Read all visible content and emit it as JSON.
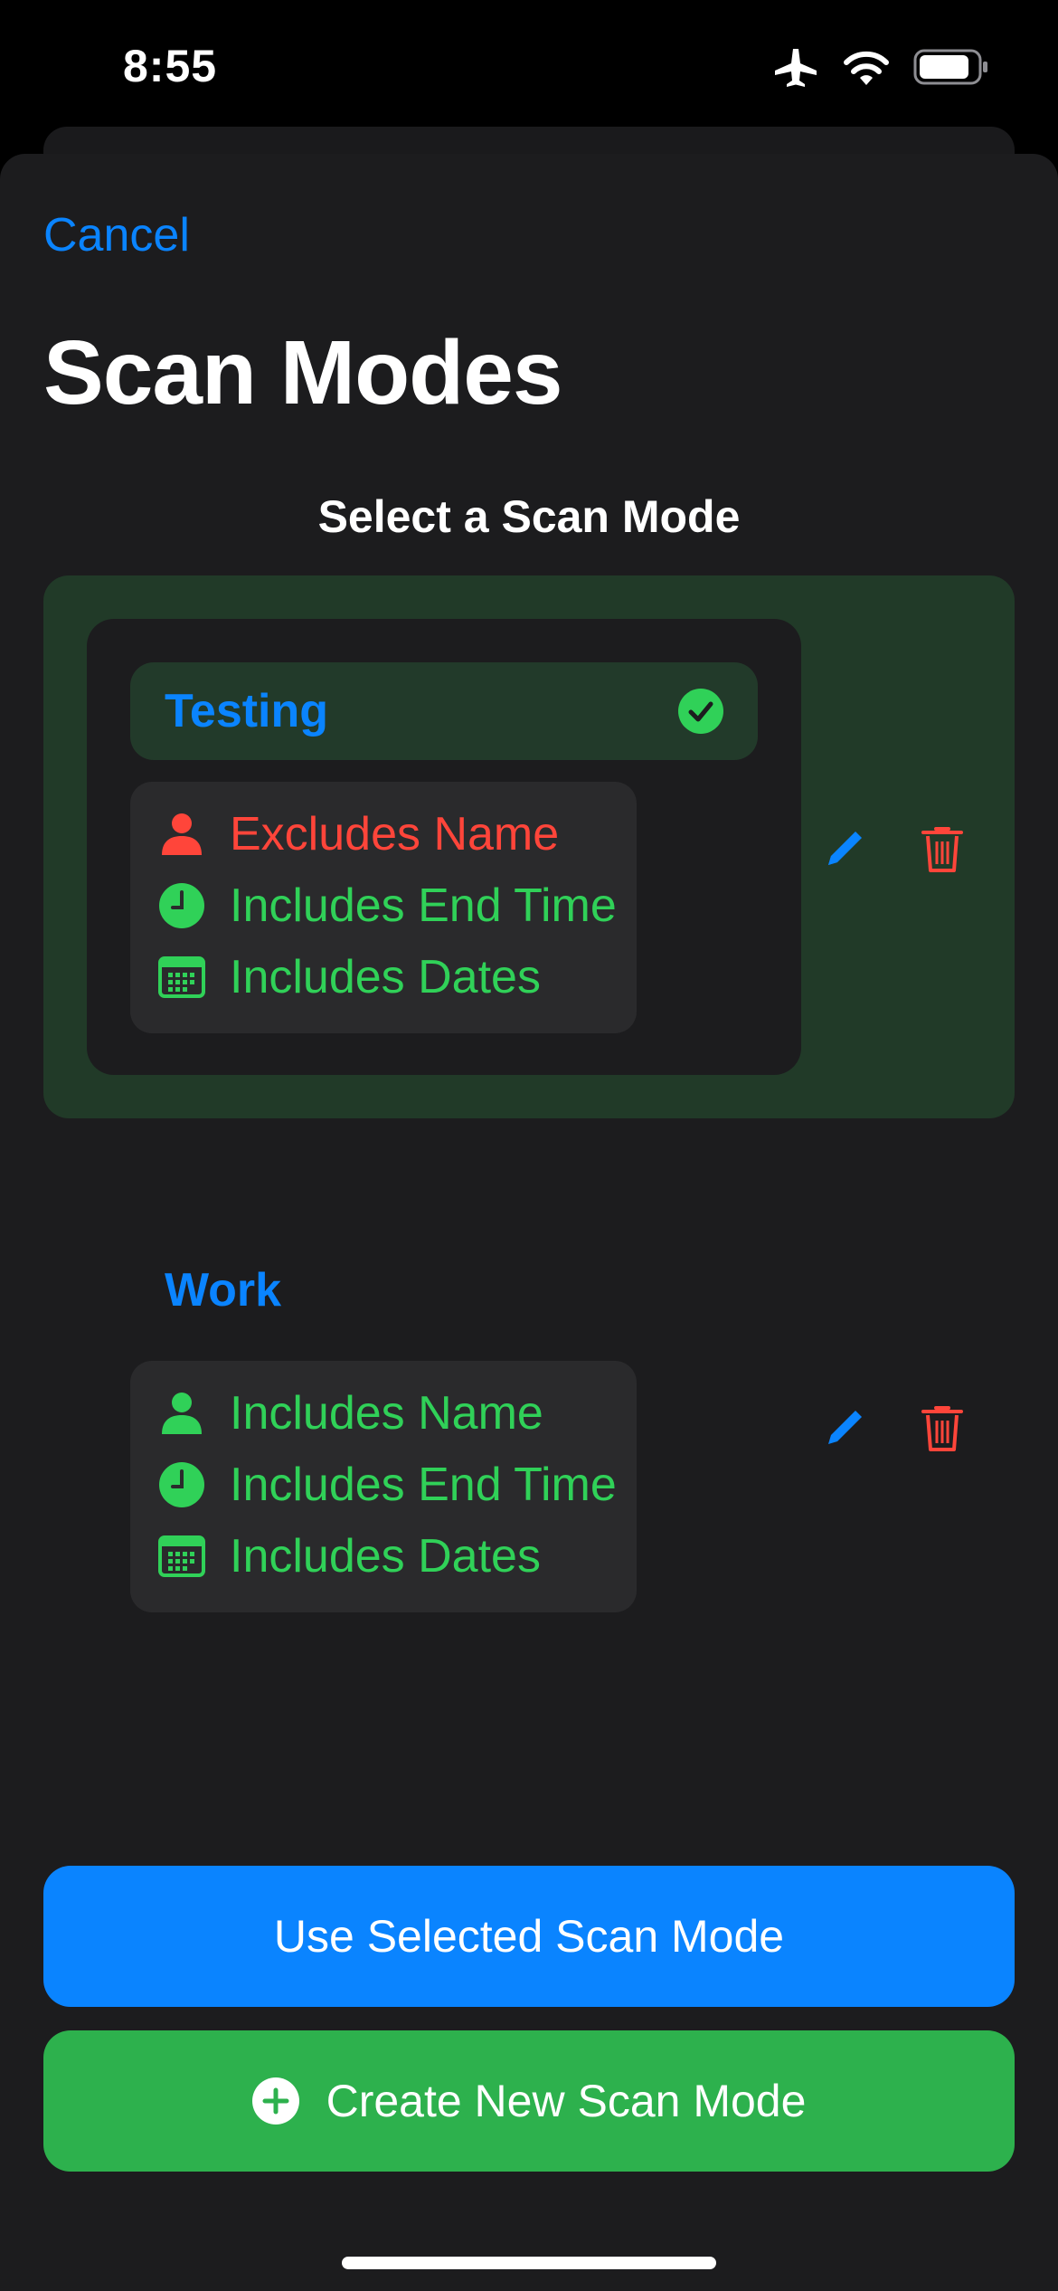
{
  "status_bar": {
    "time": "8:55",
    "icons": [
      "airplane-icon",
      "wifi-icon",
      "battery-icon"
    ]
  },
  "header": {
    "cancel_label": "Cancel",
    "title": "Scan Modes",
    "subtitle": "Select a Scan Mode"
  },
  "modes": [
    {
      "name": "Testing",
      "selected": true,
      "attributes": [
        {
          "icon": "person-icon",
          "label": "Excludes Name",
          "status": "excluded"
        },
        {
          "icon": "clock-icon",
          "label": "Includes End Time",
          "status": "included"
        },
        {
          "icon": "calendar-icon",
          "label": "Includes Dates",
          "status": "included"
        }
      ]
    },
    {
      "name": "Work",
      "selected": false,
      "attributes": [
        {
          "icon": "person-icon",
          "label": "Includes Name",
          "status": "included"
        },
        {
          "icon": "clock-icon",
          "label": "Includes End Time",
          "status": "included"
        },
        {
          "icon": "calendar-icon",
          "label": "Includes Dates",
          "status": "included"
        }
      ]
    }
  ],
  "actions": {
    "use_selected_label": "Use Selected Scan Mode",
    "create_new_label": "Create New Scan Mode"
  },
  "colors": {
    "accent_blue": "#0a84ff",
    "include_green": "#30d158",
    "exclude_red": "#ff453a",
    "selected_bg": "#213a28",
    "create_button": "#2db14d"
  }
}
